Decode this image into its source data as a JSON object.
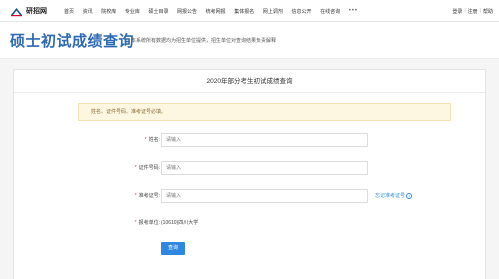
{
  "site": {
    "logo_text": "研招网"
  },
  "nav": {
    "items": [
      "首页",
      "资讯",
      "院校库",
      "专业库",
      "硕士目录",
      "网报公告",
      "统考网报",
      "集体报名",
      "网上调剂",
      "信息公开",
      "在线咨询"
    ],
    "more": "•••"
  },
  "auth": {
    "login": "登录",
    "separator": "|",
    "register": "注册",
    "separator2": "|",
    "help": "帮助"
  },
  "header": {
    "title": "硕士初试成绩查询",
    "description": "本系统所有数据均为招生单位提供，招生单位对查询结果负责解释"
  },
  "card": {
    "title": "2020年部分考生初试成绩查询",
    "notice": "姓名、证件号码、准考证号必填。"
  },
  "form": {
    "name": {
      "label": "姓名:",
      "placeholder": "请输入"
    },
    "id_number": {
      "label": "证件号码:",
      "placeholder": "请输入"
    },
    "exam_number": {
      "label": "准考证号:",
      "placeholder": "请输入"
    },
    "forgot_link": "忘记准考证号",
    "forgot_icon": "?",
    "unit": {
      "label": "报考单位:",
      "value": "(10610)四川大学"
    },
    "submit_label": "查询",
    "required_mark": "*"
  }
}
